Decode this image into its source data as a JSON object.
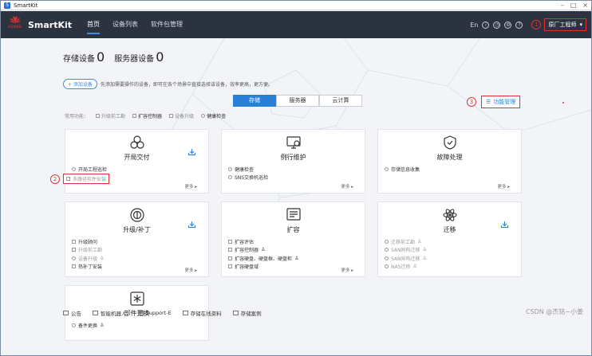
{
  "window": {
    "title": "SmartKit",
    "controls": [
      "–",
      "□",
      "×"
    ]
  },
  "brand": {
    "logo_text": "HUAWEI",
    "name": "SmartKit"
  },
  "nav": {
    "tabs": [
      {
        "label": "首页",
        "active": true
      },
      {
        "label": "设备列表"
      },
      {
        "label": "软件包管理"
      }
    ]
  },
  "topright": {
    "lang": "En",
    "icons": [
      "info-icon",
      "clock-icon",
      "settings-icon",
      "help-icon"
    ],
    "marker": "1",
    "role": "原厂工程师"
  },
  "counts": {
    "storage_label": "存储设备",
    "storage_value": "0",
    "server_label": "服务器设备",
    "server_value": "0"
  },
  "add": {
    "button": "+ 添加设备",
    "tip": "先添加需要操作的设备，即可在各个场景中直接选择该设备，效率更高，更方便。"
  },
  "segments": [
    {
      "label": "存储",
      "active": true
    },
    {
      "label": "服务器"
    },
    {
      "label": "云计算"
    }
  ],
  "func_mgr": {
    "marker": "3",
    "label": "功能管理"
  },
  "common": {
    "label": "常用功能：",
    "items": [
      "升级前工勘",
      "扩容控制器",
      "设备升级",
      "健康检查"
    ]
  },
  "cards": [
    {
      "title": "开局交付",
      "icon": "hexagon-cluster-icon",
      "download": true,
      "items": [
        {
          "text": "开局工程巡检",
          "type": "radio"
        },
        {
          "text": "多路径软件安装",
          "type": "box",
          "dim": true,
          "highlight": true
        }
      ],
      "more": "更多 ▸"
    },
    {
      "title": "例行维护",
      "icon": "monitor-icon",
      "download": false,
      "items": [
        {
          "text": "健康检查",
          "type": "radio"
        },
        {
          "text": "SNS交换机巡检",
          "type": "radio"
        }
      ],
      "more": "更多 ▸"
    },
    {
      "title": "故障处理",
      "icon": "shield-icon",
      "download": false,
      "items": [
        {
          "text": "存储信息收集",
          "type": "radio"
        }
      ],
      "more": "更多 ▸"
    },
    {
      "title": "升级/补丁",
      "icon": "upgrade-ring-icon",
      "download": true,
      "items": [
        {
          "text": "升级顾问",
          "type": "box"
        },
        {
          "text": "升级前工勘",
          "type": "box",
          "dim": true
        },
        {
          "text": "设备升级",
          "type": "radio",
          "dim": true,
          "user": true
        },
        {
          "text": "热补丁安装",
          "type": "box"
        }
      ],
      "more": "更多 ▸"
    },
    {
      "title": "扩容",
      "icon": "expand-screen-icon",
      "download": false,
      "items": [
        {
          "text": "扩容评估",
          "type": "box"
        },
        {
          "text": "扩容控制器",
          "type": "box",
          "user": true
        },
        {
          "text": "扩容硬盘、硬盘框、硬盘柜",
          "type": "box",
          "user": true
        },
        {
          "text": "扩容硬盘域",
          "type": "box"
        }
      ],
      "more": "更多 ▸"
    },
    {
      "title": "迁移",
      "icon": "atom-icon",
      "download": true,
      "items": [
        {
          "text": "迁移前工勘",
          "type": "radio",
          "dim": true,
          "user": true
        },
        {
          "text": "SAN同构迁移",
          "type": "radio",
          "dim": true,
          "user": true
        },
        {
          "text": "SAN异构迁移",
          "type": "radio",
          "dim": true,
          "user": true
        },
        {
          "text": "NAS迁移",
          "type": "radio",
          "dim": true,
          "user": true
        }
      ],
      "more": "更多 ▸"
    },
    {
      "title": "部件更换",
      "icon": "snowflake-icon",
      "download": false,
      "items": [
        {
          "text": "备件更换",
          "type": "radio",
          "user": true
        }
      ],
      "more": ""
    }
  ],
  "marker2": "2",
  "footer": [
    "公告",
    "智能机器人",
    "Support-E",
    "存储在线资料",
    "存储案例"
  ],
  "watermark": "CSDN @杰铭~小姜",
  "colors": {
    "accent": "#2a7fd8",
    "annotation": "#e03030",
    "topbar": "#2b3340"
  }
}
